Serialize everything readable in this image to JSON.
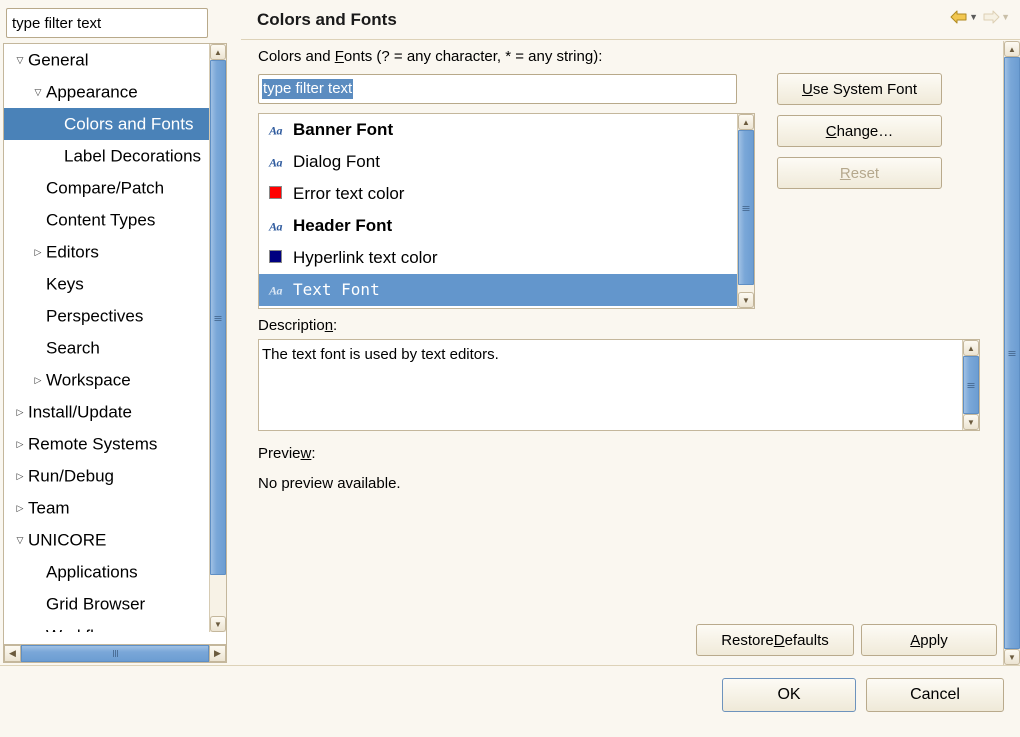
{
  "window": {
    "background_color": "#faf7f0",
    "accent_blue": "#4a82b8",
    "selection_blue": "#6396cc",
    "border_color": "#c4b79c"
  },
  "sidebar": {
    "filter": {
      "value": "type filter text",
      "placeholder": "type filter text"
    },
    "tree": [
      {
        "label": "General",
        "indent": 0,
        "state": "expanded",
        "selected": false
      },
      {
        "label": "Appearance",
        "indent": 1,
        "state": "expanded",
        "selected": false
      },
      {
        "label": "Colors and Fonts",
        "indent": 2,
        "state": "leaf",
        "selected": true
      },
      {
        "label": "Label Decorations",
        "indent": 2,
        "state": "leaf",
        "selected": false
      },
      {
        "label": "Compare/Patch",
        "indent": 1,
        "state": "leaf",
        "selected": false
      },
      {
        "label": "Content Types",
        "indent": 1,
        "state": "leaf",
        "selected": false
      },
      {
        "label": "Editors",
        "indent": 1,
        "state": "collapsed",
        "selected": false
      },
      {
        "label": "Keys",
        "indent": 1,
        "state": "leaf",
        "selected": false
      },
      {
        "label": "Perspectives",
        "indent": 1,
        "state": "leaf",
        "selected": false
      },
      {
        "label": "Search",
        "indent": 1,
        "state": "leaf",
        "selected": false
      },
      {
        "label": "Workspace",
        "indent": 1,
        "state": "collapsed",
        "selected": false
      },
      {
        "label": "Install/Update",
        "indent": 0,
        "state": "collapsed",
        "selected": false
      },
      {
        "label": "Remote Systems",
        "indent": 0,
        "state": "collapsed",
        "selected": false
      },
      {
        "label": "Run/Debug",
        "indent": 0,
        "state": "collapsed",
        "selected": false
      },
      {
        "label": "Team",
        "indent": 0,
        "state": "collapsed",
        "selected": false
      },
      {
        "label": "UNICORE",
        "indent": 0,
        "state": "expanded",
        "selected": false
      },
      {
        "label": "Applications",
        "indent": 1,
        "state": "leaf",
        "selected": false
      },
      {
        "label": "Grid Browser",
        "indent": 1,
        "state": "leaf",
        "selected": false
      },
      {
        "label": "Workflows",
        "indent": 1,
        "state": "leaf",
        "selected": false
      }
    ],
    "vscrollbar": {
      "up_icon": "chevron-up-icon",
      "down_icon": "chevron-down-icon"
    },
    "hscrollbar": {
      "left_icon": "chevron-left-icon",
      "right_icon": "chevron-right-icon"
    }
  },
  "page": {
    "title": "Colors and Fonts",
    "nav": {
      "back_icon": "back-arrow-icon",
      "back_caret_icon": "chevron-down-icon",
      "forward_icon": "forward-arrow-icon",
      "forward_caret_icon": "chevron-down-icon",
      "back_enabled": true,
      "forward_enabled": false
    },
    "filter_label_pre": "Colors and ",
    "filter_label_mnemonic": "F",
    "filter_label_post": "onts (? = any character, * = any string):",
    "filter": {
      "value": "type filter text",
      "placeholder": "type filter text",
      "selected": true
    },
    "font_list": [
      {
        "label": "Banner Font",
        "icon": "font-aa-icon",
        "style": "bold",
        "selected": false
      },
      {
        "label": "Dialog Font",
        "icon": "font-aa-icon",
        "style": "normal",
        "selected": false
      },
      {
        "label": "Error text color",
        "icon": "color-swatch",
        "style": "normal",
        "selected": false,
        "color": "#ff0000"
      },
      {
        "label": "Header Font",
        "icon": "font-aa-icon",
        "style": "bold",
        "selected": false
      },
      {
        "label": "Hyperlink text color",
        "icon": "color-swatch",
        "style": "normal",
        "selected": false,
        "color": "#000080"
      },
      {
        "label": "Text Font",
        "icon": "font-aa-icon",
        "style": "mono",
        "selected": true
      }
    ],
    "buttons": {
      "use_system_font_pre": "",
      "use_system_font_mnemonic": "U",
      "use_system_font_post": "se System Font",
      "change_pre": "",
      "change_mnemonic": "C",
      "change_post": "hange…",
      "reset_pre": "",
      "reset_mnemonic": "R",
      "reset_post": "eset",
      "reset_enabled": false
    },
    "description_label_pre": "Descriptio",
    "description_label_mnemonic": "n",
    "description_label_post": ":",
    "description_text": "The text font is used by text editors.",
    "preview_label_pre": "Previe",
    "preview_label_mnemonic": "w",
    "preview_label_post": ":",
    "preview_text": "No preview available.",
    "restore_defaults_pre": "Restore ",
    "restore_defaults_mnemonic": "D",
    "restore_defaults_post": "efaults",
    "apply_pre": "",
    "apply_mnemonic": "A",
    "apply_post": "pply"
  },
  "footer": {
    "ok_label": "OK",
    "cancel_label": "Cancel"
  }
}
